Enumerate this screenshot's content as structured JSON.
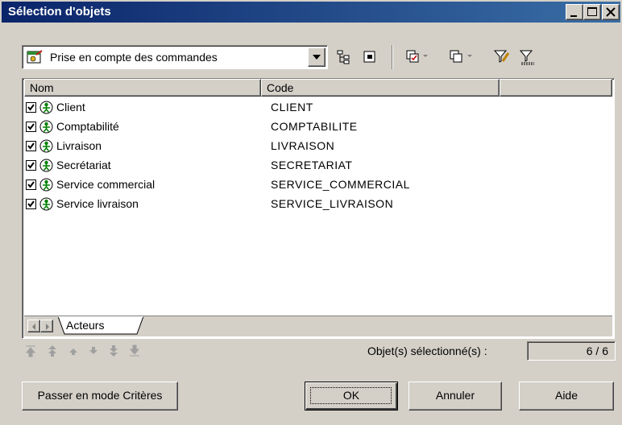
{
  "window": {
    "title": "Sélection d'objets"
  },
  "toolbar": {
    "combo_value": "Prise en compte des commandes",
    "tool_icons": [
      "hierarchy-icon",
      "properties-icon",
      "select-all-icon",
      "deselect-all-icon",
      "filter-edit-icon",
      "filter-icon"
    ]
  },
  "list": {
    "columns": [
      "Nom",
      "Code"
    ],
    "rows": [
      {
        "name": "Client",
        "code": "CLIENT",
        "checked": true
      },
      {
        "name": "Comptabilité",
        "code": "COMPTABILITE",
        "checked": true
      },
      {
        "name": "Livraison",
        "code": "LIVRAISON",
        "checked": true
      },
      {
        "name": "Secrétariat",
        "code": "SECRETARIAT",
        "checked": true
      },
      {
        "name": "Service commercial",
        "code": "SERVICE_COMMERCIAL",
        "checked": true
      },
      {
        "name": "Service livraison",
        "code": "SERVICE_LIVRAISON",
        "checked": true
      }
    ]
  },
  "tabs": {
    "active": "Acteurs"
  },
  "status": {
    "selected_label": "Objet(s) sélectionné(s) :",
    "selected_count": "6 / 6"
  },
  "buttons": {
    "criteria": "Passer en mode Critères",
    "ok": "OK",
    "cancel": "Annuler",
    "help": "Aide"
  },
  "colors": {
    "title_start": "#0a246a",
    "title_end": "#3a6ea5",
    "actor_green": "#008000",
    "face": "#d4d0c8"
  }
}
